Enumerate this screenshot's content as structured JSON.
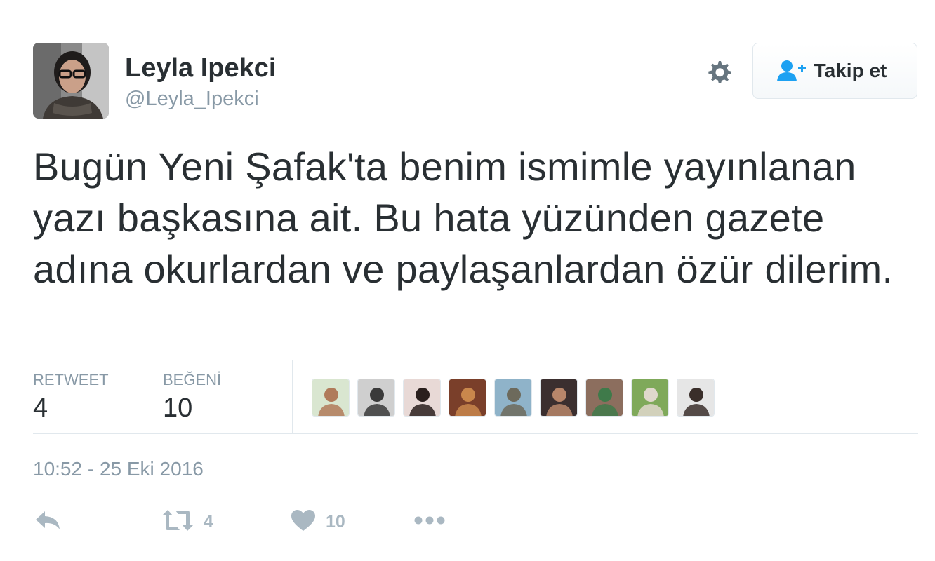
{
  "author": {
    "name": "Leyla Ipekci",
    "handle": "@Leyla_Ipekci"
  },
  "follow_button": {
    "label": "Takip et",
    "icon": "add-user-icon"
  },
  "tweet": {
    "text": "Bugün Yeni Şafak'ta benim ismimle yayınlanan yazı başkasına ait. Bu hata yüzünden gazete adına okurlardan ve paylaşanlardan özür dilerim."
  },
  "stats": {
    "retweet_label": "RETWEET",
    "retweet_count": "4",
    "like_label": "BEĞENİ",
    "like_count": "10"
  },
  "likers": [
    {
      "bg": "#d9e6d0",
      "fg": "#b07a5a"
    },
    {
      "bg": "#cfcfcf",
      "fg": "#3a3a3a"
    },
    {
      "bg": "#e8d9d6",
      "fg": "#2a1f1d"
    },
    {
      "bg": "#7a3f2a",
      "fg": "#c9874c"
    },
    {
      "bg": "#8fb3c9",
      "fg": "#6d6a5c"
    },
    {
      "bg": "#3b2f2f",
      "fg": "#b8866a"
    },
    {
      "bg": "#8c6e5e",
      "fg": "#3f7a4a"
    },
    {
      "bg": "#7fa95a",
      "fg": "#e0d8cc"
    },
    {
      "bg": "#e6e6e6",
      "fg": "#3a2e2a"
    }
  ],
  "timestamp": "10:52 - 25 Eki 2016",
  "actions": {
    "reply_icon": "reply-icon",
    "retweet_icon": "retweet-icon",
    "retweet_count": "4",
    "like_icon": "heart-icon",
    "like_count": "10",
    "more_icon": "more-icon"
  },
  "colors": {
    "text": "#292f33",
    "secondary": "#8899a6",
    "action_gray": "#aab8c2",
    "follow_icon_blue": "#1da1f2",
    "border": "#e1e8ed"
  }
}
